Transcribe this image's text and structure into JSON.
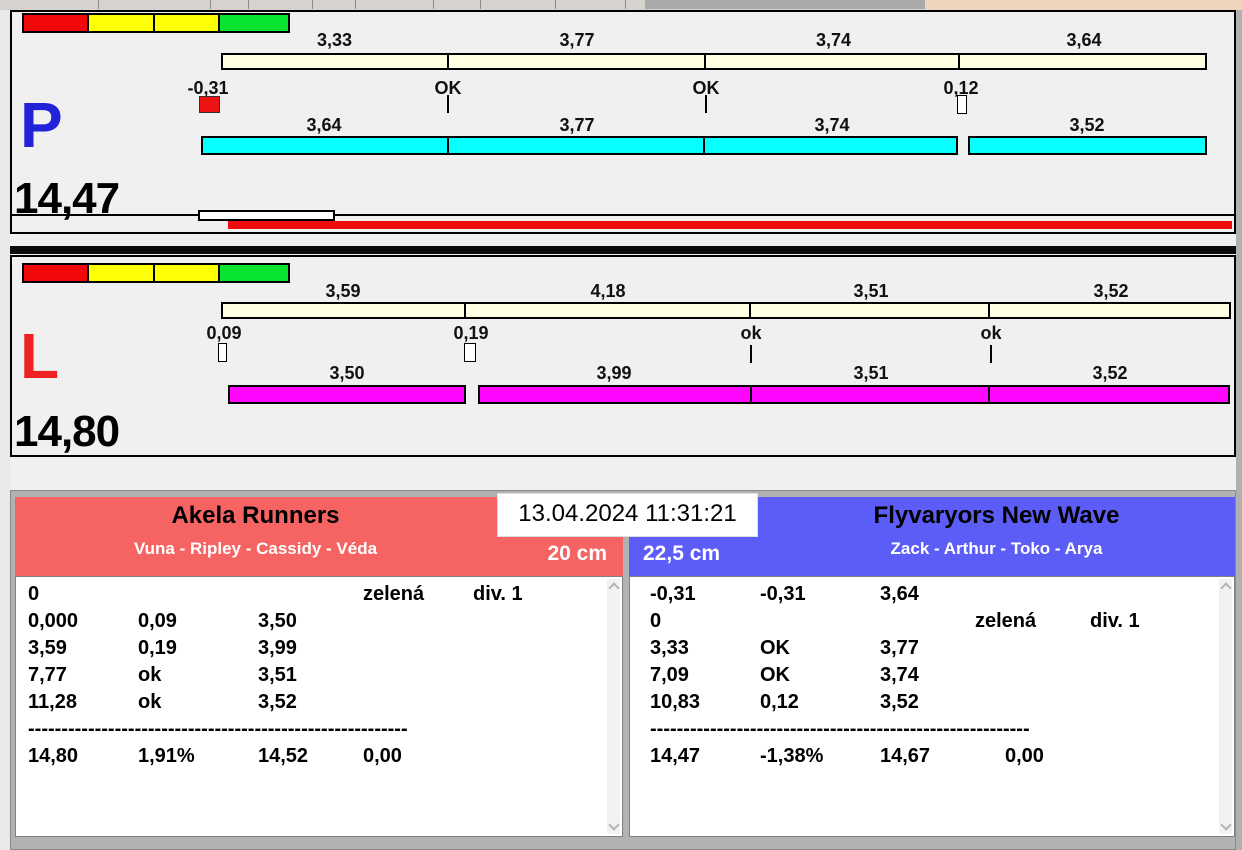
{
  "datetime": "13.04.2024 11:31:21",
  "lanes": {
    "P": {
      "letter": "P",
      "total": "14,47",
      "gate_labels": [
        "3,33",
        "3,77",
        "3,74",
        "3,64"
      ],
      "status_labels": [
        "-0,31",
        "OK",
        "OK",
        "0,12"
      ],
      "run_labels": [
        "3,64",
        "3,77",
        "3,74",
        "3,52"
      ]
    },
    "L": {
      "letter": "L",
      "total": "14,80",
      "gate_labels": [
        "3,59",
        "4,18",
        "3,51",
        "3,52"
      ],
      "status_labels": [
        "0,09",
        "0,19",
        "ok",
        "ok"
      ],
      "run_labels": [
        "3,50",
        "3,99",
        "3,51",
        "3,52"
      ]
    }
  },
  "teams": {
    "left": {
      "name": "Akela Runners",
      "lineup": "Vuna - Ripley - Cassidy - Véda",
      "jump_height": "20 cm",
      "rows": [
        {
          "c1": "0",
          "c2": "",
          "c3": "",
          "c4": "zelená",
          "c5": "div. 1"
        },
        {
          "c1": "0,000",
          "c2": "0,09",
          "c3": "3,50",
          "c4": "",
          "c5": ""
        },
        {
          "c1": "3,59",
          "c2": "0,19",
          "c3": "3,99",
          "c4": "",
          "c5": ""
        },
        {
          "c1": "7,77",
          "c2": "ok",
          "c3": "3,51",
          "c4": "",
          "c5": ""
        },
        {
          "c1": "11,28",
          "c2": "ok",
          "c3": "3,52",
          "c4": "",
          "c5": ""
        }
      ],
      "divider": "------------------------------------------------------------",
      "summary": {
        "c1": "14,80",
        "c2": "1,91%",
        "c3": "14,52",
        "c4": "0,00"
      }
    },
    "right": {
      "name": "Flyvaryors New Wave",
      "lineup": "Zack - Arthur - Toko - Arya",
      "jump_height": "22,5 cm",
      "rows": [
        {
          "c1": "-0,31",
          "c2": "-0,31",
          "c3": "3,64",
          "c4": "",
          "c5": ""
        },
        {
          "c1": "0",
          "c2": "",
          "c3": "",
          "c4": "zelená",
          "c5": "div. 1"
        },
        {
          "c1": "3,33",
          "c2": "OK",
          "c3": "3,77",
          "c4": "",
          "c5": ""
        },
        {
          "c1": "7,09",
          "c2": "OK",
          "c3": "3,74",
          "c4": "",
          "c5": ""
        },
        {
          "c1": "10,83",
          "c2": "0,12",
          "c3": "3,52",
          "c4": "",
          "c5": ""
        }
      ],
      "divider": "------------------------------------------------------------",
      "summary": {
        "c1": "14,47",
        "c2": "-1,38%",
        "c3": "14,67",
        "c4": "0,00"
      }
    }
  },
  "colors": {
    "traffic_red": "#f10808",
    "traffic_yellow": "#ffff06",
    "traffic_green": "#08e42d",
    "gate_bar": "#ffffe2",
    "run_bar_p": "#06ffff",
    "run_bar_l": "#ff06ff",
    "lane_p_letter": "#2222d8",
    "lane_l_letter": "#ee2222",
    "penalty_marker": "#ee1414",
    "progress_bar": "#ee0d0d",
    "team_left_header": "#f66363",
    "team_right_header": "#5c5cf6",
    "top_strip_tan": "#eed6bc"
  }
}
